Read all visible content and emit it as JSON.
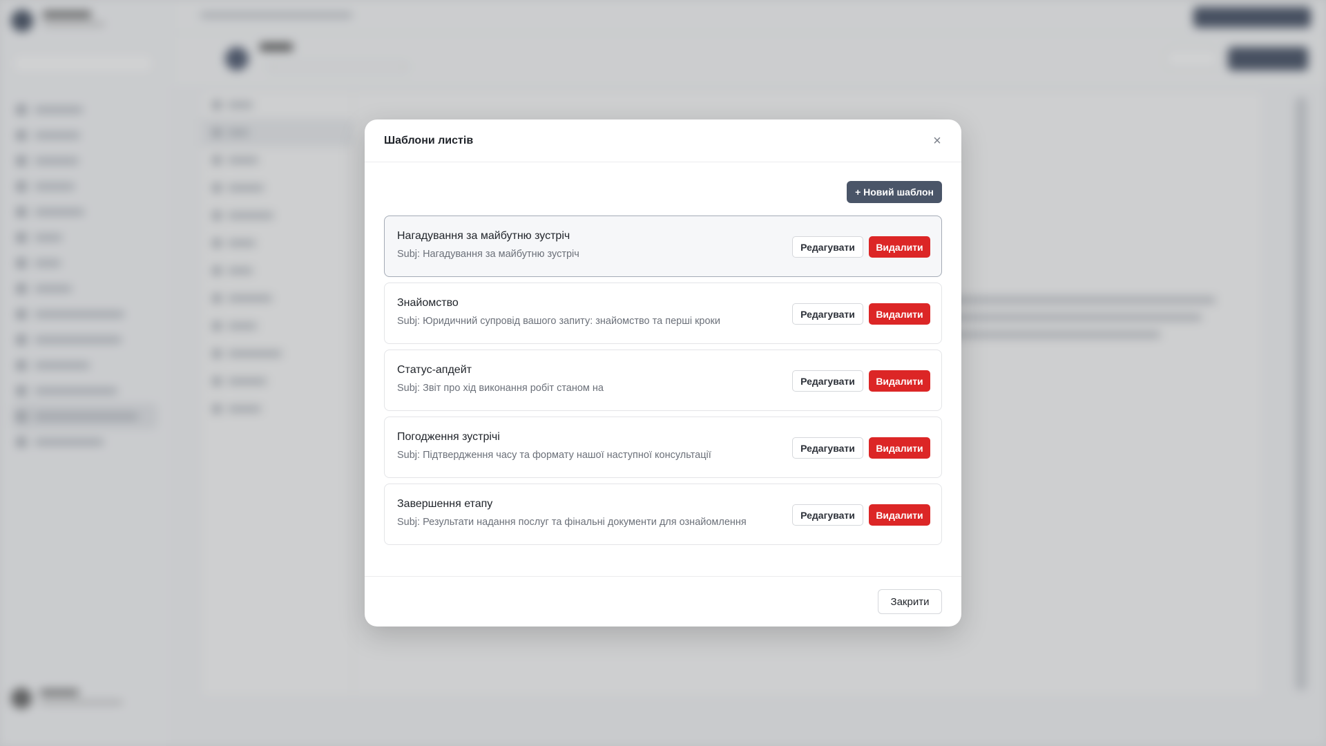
{
  "modal": {
    "title": "Шаблони листів",
    "new_button": "+ Новий шаблон",
    "close_button": "Закрити",
    "close_icon": "×",
    "edit_label": "Редагувати",
    "delete_label": "Видалити",
    "templates": [
      {
        "name": "Нагадування за майбутню зустріч",
        "subject": "Subj: Нагадування за майбутню зустріч"
      },
      {
        "name": "Знайомство",
        "subject": "Subj: Юридичний супровід вашого запиту: знайомство та перші кроки"
      },
      {
        "name": "Статус-апдейт",
        "subject": "Subj: Звіт про хід виконання робіт станом на"
      },
      {
        "name": "Погодження зустрічі",
        "subject": "Subj: Підтвердження часу та формату нашої наступної консультації"
      },
      {
        "name": "Завершення етапу",
        "subject": "Subj: Результати надання послуг та фінальні документи для ознайомлення"
      }
    ]
  },
  "colors": {
    "primary_button": "#4a5568",
    "danger_button": "#dc2626"
  }
}
